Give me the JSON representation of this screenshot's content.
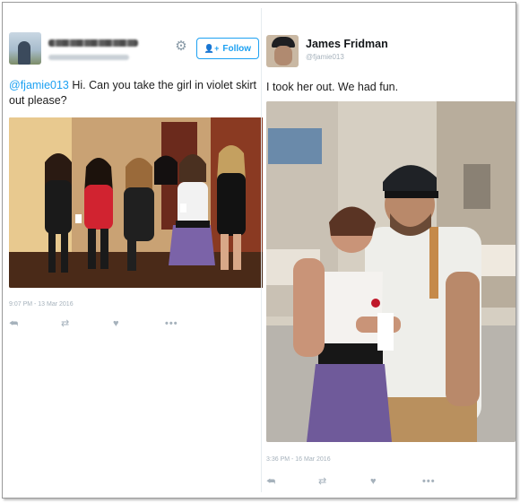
{
  "left_tweet": {
    "mention": "@fjamie013",
    "text": " Hi. Can you take the girl in violet skirt out please?",
    "follow_label": "Follow",
    "timestamp": "9:07 PM - 13 Mar 2016",
    "icons": [
      "reply-icon",
      "retweet-icon",
      "like-icon",
      "more-icon"
    ]
  },
  "right_tweet": {
    "name": "James Fridman",
    "handle": "@fjamie013",
    "text": "I took her out. We had fun.",
    "timestamp": "3:36 PM - 16 Mar 2016",
    "icons": [
      "reply-icon",
      "retweet-icon",
      "like-icon",
      "more-icon"
    ]
  },
  "colors": {
    "twitter_blue": "#1da1f2",
    "muted": "#a6b2bc"
  }
}
